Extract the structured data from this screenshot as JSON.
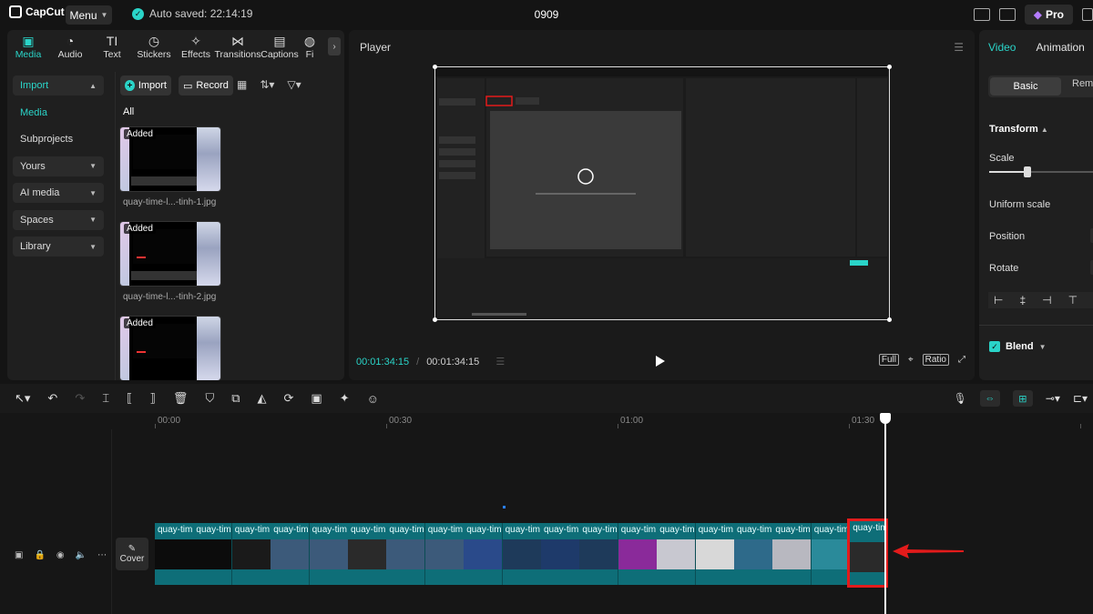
{
  "app": {
    "logo": "CapCut",
    "menu_label": "Menu",
    "autosave": "Auto saved: 22:14:19",
    "project_title": "0909",
    "pro_label": "Pro"
  },
  "left_panel": {
    "tabs": [
      {
        "label": "Media",
        "icon": "▣"
      },
      {
        "label": "Audio",
        "icon": "◔"
      },
      {
        "label": "Text",
        "icon": "TI"
      },
      {
        "label": "Stickers",
        "icon": "◷"
      },
      {
        "label": "Effects",
        "icon": "✧"
      },
      {
        "label": "Transitions",
        "icon": "⋈"
      },
      {
        "label": "Captions",
        "icon": "▤"
      },
      {
        "label": "Fi",
        "icon": "◍"
      }
    ],
    "nav": {
      "import": "Import",
      "media": "Media",
      "subprojects": "Subprojects",
      "yours": "Yours",
      "ai_media": "AI media",
      "spaces": "Spaces",
      "library": "Library"
    },
    "import_button": "Import",
    "record_button": "Record",
    "all_label": "All",
    "media_items": [
      {
        "badge": "Added",
        "caption": "quay-time-l...-tinh-1.jpg"
      },
      {
        "badge": "Added",
        "caption": "quay-time-l...-tinh-2.jpg"
      },
      {
        "badge": "Added",
        "caption": ""
      }
    ]
  },
  "player": {
    "title": "Player",
    "current_time": "00:01:34:15",
    "total_time": "00:01:34:15",
    "full_label": "Full",
    "ratio_label": "Ratio"
  },
  "right_panel": {
    "tab_video": "Video",
    "tab_animation": "Animation",
    "seg_basic": "Basic",
    "seg_remove": "Rem",
    "transform": "Transform",
    "scale": "Scale",
    "uniform_scale": "Uniform scale",
    "position": "Position",
    "rotate": "Rotate",
    "blend": "Blend",
    "scale_fraction": 0.3
  },
  "timeline": {
    "ruler": [
      "00:00",
      "00:30",
      "01:00",
      "01:30"
    ],
    "cover_label": "Cover",
    "clip_name": "quay-tim",
    "last_clip_name": "quay-tim",
    "clip_count": 19
  },
  "colors": {
    "accent": "#2ad4c8",
    "clip": "#0e6e78",
    "highlight": "#e31b1b"
  }
}
